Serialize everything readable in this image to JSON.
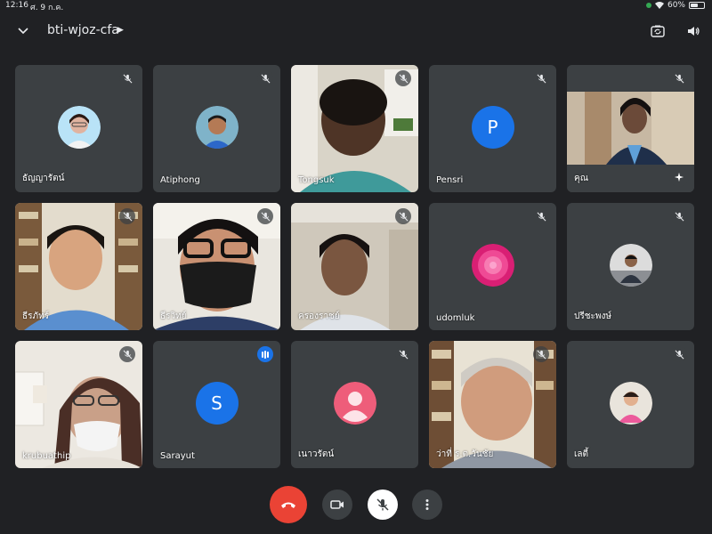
{
  "status": {
    "time": "12:16",
    "date": "ศ. 9 ก.ค.",
    "battery": "60%",
    "battery_level": 0.6
  },
  "meeting": {
    "code": "bti-wjoz-cfa"
  },
  "participants": [
    {
      "name": "ธัญญารัตน์",
      "type": "avatar",
      "muted": true
    },
    {
      "name": "Atiphong",
      "type": "avatar",
      "muted": true
    },
    {
      "name": "Tongsuk",
      "type": "video",
      "muted": true
    },
    {
      "name": "Pensri",
      "type": "letter",
      "letter": "P",
      "color": "#1a73e8",
      "muted": true
    },
    {
      "name": "คุณ",
      "type": "video",
      "muted": true
    },
    {
      "name": "ธีรภัทร์",
      "type": "video",
      "muted": true
    },
    {
      "name": "ธีรวิทย์",
      "type": "video",
      "muted": true
    },
    {
      "name": "ครองราชย์",
      "type": "video",
      "muted": true
    },
    {
      "name": "udomluk",
      "type": "avatar",
      "muted": true
    },
    {
      "name": "ปรีชะพงษ์",
      "type": "avatar",
      "muted": true
    },
    {
      "name": "krubuathip",
      "type": "video",
      "muted": true
    },
    {
      "name": "Sarayut",
      "type": "letter",
      "letter": "S",
      "color": "#1a73e8",
      "muted": false
    },
    {
      "name": "เนาวรัตน์",
      "type": "default-avatar",
      "color": "#ee5d7a",
      "muted": true
    },
    {
      "name": "ว่าที่ ร.ต.วันชัย",
      "type": "video",
      "muted": true
    },
    {
      "name": "เลตี้",
      "type": "avatar",
      "muted": true
    }
  ],
  "icons": {
    "back": "chevron-down-icon",
    "switch_camera": "camera-switch-icon",
    "audio": "speaker-icon",
    "end_call": "phone-hangup-icon",
    "camera": "video-camera-icon",
    "microphone": "mic-off-icon",
    "more": "more-vert-icon"
  },
  "colors": {
    "background": "#202124",
    "tile": "#3c4043",
    "end_call": "#ea4335",
    "accent": "#1a73e8"
  }
}
